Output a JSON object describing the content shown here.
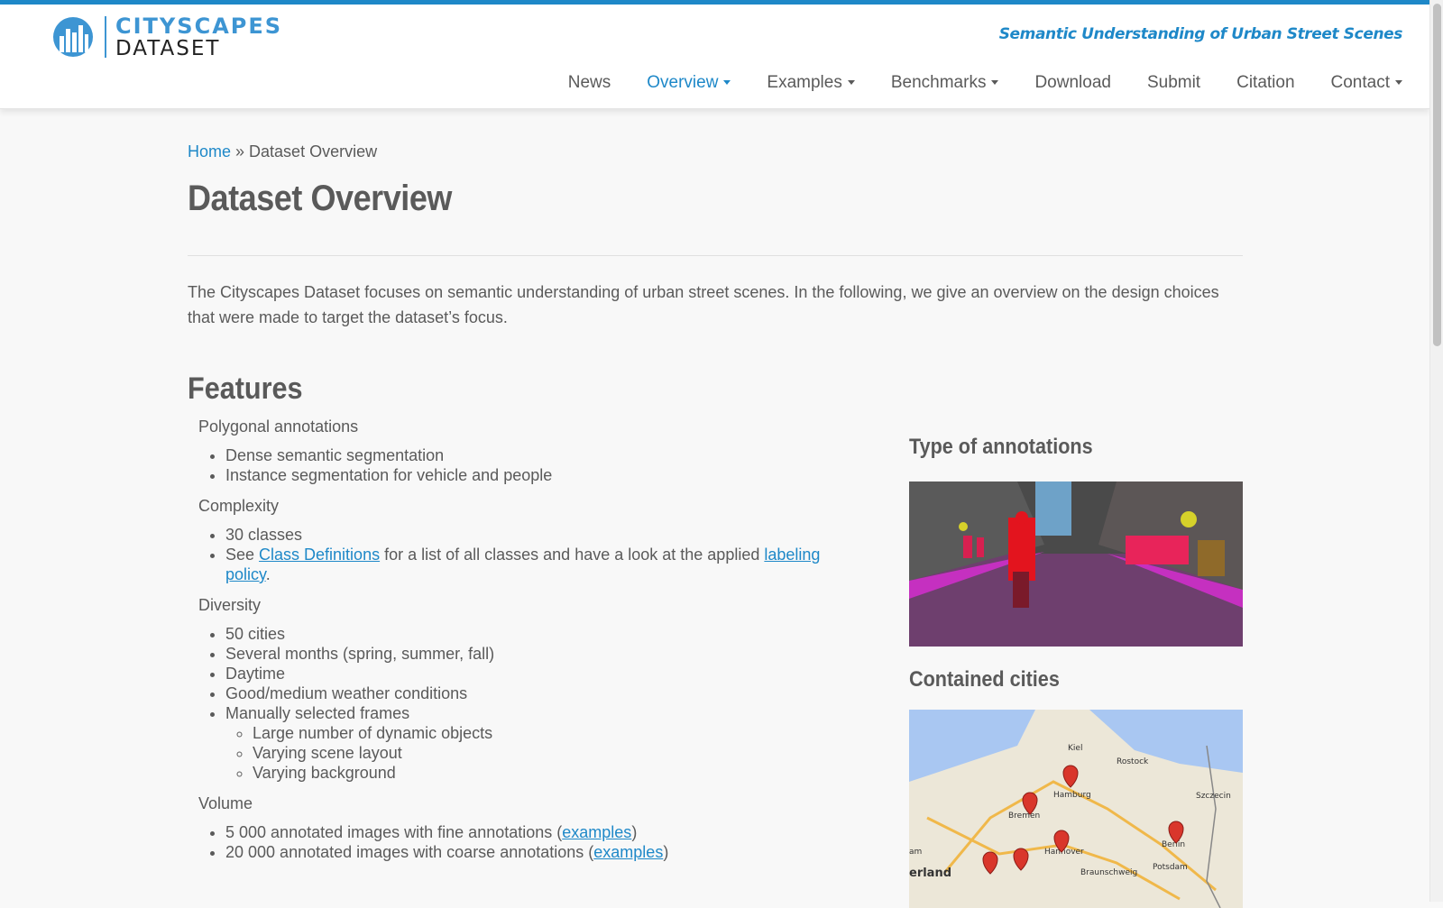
{
  "header": {
    "logo_line1": "CITYSCAPES",
    "logo_line2": "DATASET",
    "tagline": "Semantic Understanding of Urban Street Scenes",
    "accent_color": "#1e88c8"
  },
  "nav": {
    "items": [
      {
        "label": "News",
        "has_caret": false,
        "active": false
      },
      {
        "label": "Overview",
        "has_caret": true,
        "active": true
      },
      {
        "label": "Examples",
        "has_caret": true,
        "active": false
      },
      {
        "label": "Benchmarks",
        "has_caret": true,
        "active": false
      },
      {
        "label": "Download",
        "has_caret": false,
        "active": false
      },
      {
        "label": "Submit",
        "has_caret": false,
        "active": false
      },
      {
        "label": "Citation",
        "has_caret": false,
        "active": false
      },
      {
        "label": "Contact",
        "has_caret": true,
        "active": false
      }
    ]
  },
  "breadcrumb": {
    "home": "Home",
    "separator": " » ",
    "current": "Dataset Overview"
  },
  "page": {
    "title": "Dataset Overview",
    "intro": "The Cityscapes Dataset focuses on semantic understanding of urban street scenes. In the following, we give an overview on the design choices that were made to target the dataset’s focus."
  },
  "features": {
    "title": "Features",
    "polygonal": {
      "label": "Polygonal annotations",
      "items": [
        "Dense semantic segmentation",
        "Instance segmentation for vehicle and people"
      ]
    },
    "complexity": {
      "label": "Complexity",
      "item1": "30 classes",
      "see": "See ",
      "class_link": "Class Definitions",
      "middle": " for a list of all classes and have a look at the applied ",
      "policy_link": "labeling policy",
      "end": "."
    },
    "diversity": {
      "label": "Diversity",
      "items": [
        "50 cities",
        "Several months (spring, summer, fall)",
        "Daytime",
        "Good/medium weather conditions",
        "Manually selected frames"
      ],
      "subitems": [
        "Large number of dynamic objects",
        "Varying scene layout",
        "Varying background"
      ]
    },
    "volume": {
      "label": "Volume",
      "item1_pre": "5 000 annotated images with fine annotations (",
      "item1_link": "examples",
      "item1_post": ")",
      "item2_pre": "20 000 annotated images with coarse annotations (",
      "item2_link": "examples",
      "item2_post": ")"
    }
  },
  "sidebar": {
    "annotations_title": "Type of annotations",
    "cities_title": "Contained cities",
    "map_labels": [
      "Kiel",
      "Rostock",
      "Hamburg",
      "Bremen",
      "Szczecin",
      "Hannover",
      "Berlin",
      "Braunschweig",
      "Potsdam",
      "erland",
      "am"
    ]
  }
}
